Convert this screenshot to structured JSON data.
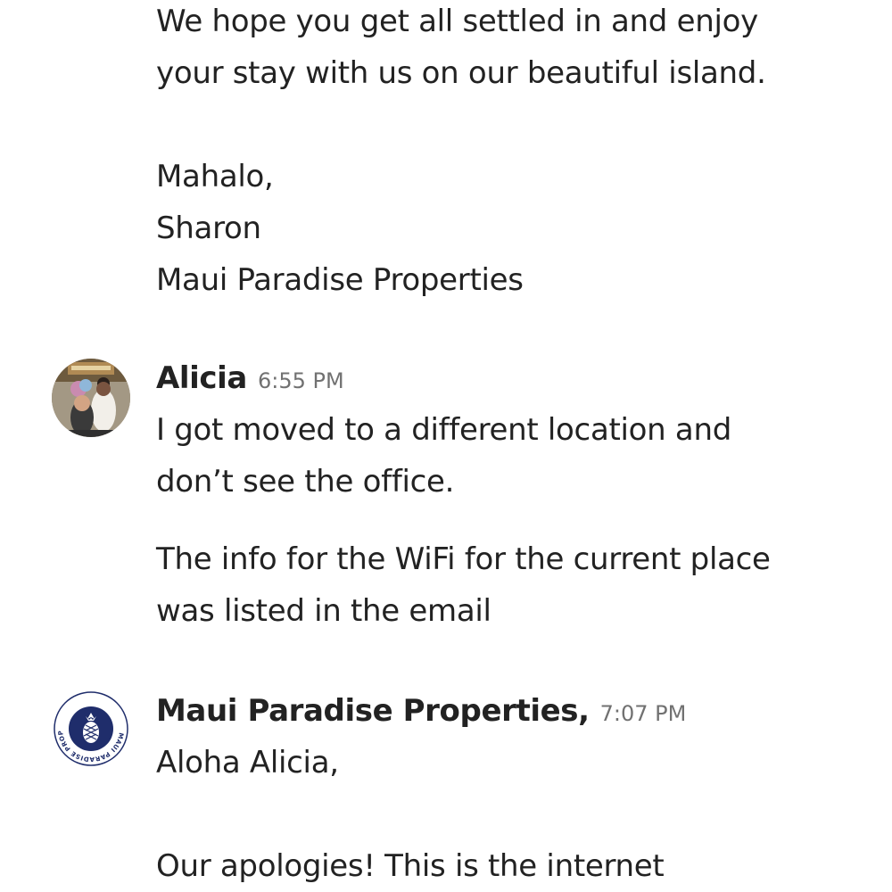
{
  "messages": [
    {
      "lines": [
        "We hope you get all settled in and enjoy",
        "your stay with us on our beautiful island.",
        "Mahalo,",
        "Sharon",
        "Maui Paradise Properties"
      ]
    },
    {
      "sender": "Alicia",
      "time": "6:55 PM",
      "avatar": "user-photo-avatar",
      "lines": [
        "I got moved to a different location and",
        "don’t see the office.",
        "The info for the WiFi for the current place",
        "was listed in the email"
      ]
    },
    {
      "sender": "Maui Paradise Properties,",
      "time": "7:07 PM",
      "avatar": "pineapple-logo-avatar",
      "logo_text": "MAUI PARADISE PROPERTIES",
      "lines": [
        "Aloha Alicia,",
        "Our apologies!  This is the internet"
      ]
    }
  ],
  "colors": {
    "text": "#222222",
    "timestamp": "#717171",
    "logo_navy": "#1f2d6b"
  }
}
